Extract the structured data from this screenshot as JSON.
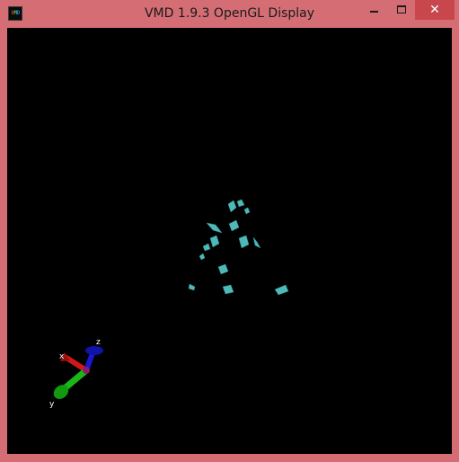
{
  "window": {
    "title": "VMD 1.9.3 OpenGL Display",
    "icon": "vmd-app-icon",
    "icon_text": [
      "V",
      "M",
      "D"
    ],
    "controls": {
      "minimize": "minimize-icon",
      "maximize": "maximize-icon",
      "close_glyph": "✕"
    },
    "frame_color": "#d46e74",
    "close_color": "#c7474c"
  },
  "display": {
    "background": "#000000",
    "molecule_color": "#4fb8b8",
    "axes": {
      "x_label": "x",
      "y_label": "y",
      "z_label": "z",
      "x_color": "#d01818",
      "y_color": "#18b818",
      "z_color": "#1818d0"
    }
  }
}
